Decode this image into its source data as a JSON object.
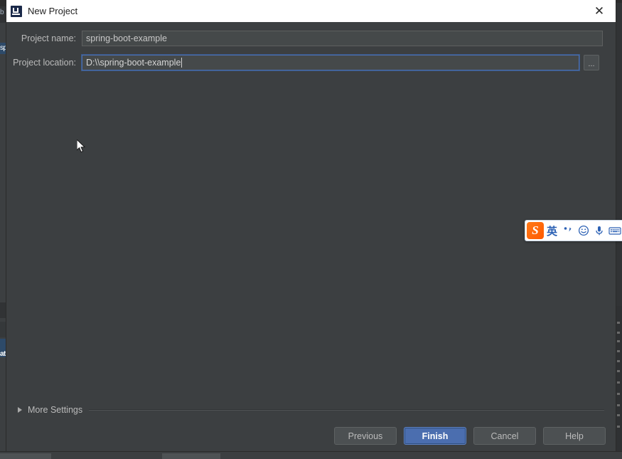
{
  "window": {
    "title": "New Project",
    "app_icon": "intellij-idea-icon",
    "close_label": "✕"
  },
  "form": {
    "fields": [
      {
        "label": "Project name:",
        "value": "spring-boot-example",
        "placeholder": "",
        "focused": false,
        "name": "project-name"
      },
      {
        "label": "Project location:",
        "value": "D:\\\\spring-boot-example",
        "placeholder": "",
        "focused": true,
        "name": "project-location"
      }
    ],
    "browse_label": "..."
  },
  "more_settings": {
    "label": "More Settings",
    "expanded": false,
    "chevron": "chevron-right-icon"
  },
  "buttons": [
    {
      "label": "Previous",
      "primary": false,
      "name": "previous-button"
    },
    {
      "label": "Finish",
      "primary": true,
      "name": "finish-button"
    },
    {
      "label": "Cancel",
      "primary": false,
      "name": "cancel-button"
    },
    {
      "label": "Help",
      "primary": false,
      "name": "help-button"
    }
  ],
  "ime": {
    "logo": "S",
    "items": [
      {
        "glyph": "英",
        "name": "ime-language-mode",
        "kind": "cjk"
      },
      {
        "glyph": "‶,",
        "name": "ime-punctuation-toggle",
        "kind": "punct"
      },
      {
        "glyph": "☺",
        "name": "ime-emoji-icon",
        "kind": "icon"
      },
      {
        "glyph": "Ἲ4",
        "name": "ime-microphone-icon",
        "kind": "icon"
      },
      {
        "glyph": "⌨",
        "name": "ime-keyboard-icon",
        "kind": "icon"
      }
    ]
  },
  "ide_background": {
    "left_sliver_labels": [
      "b",
      "sp",
      "at"
    ],
    "right_marker_count": 11
  },
  "colors": {
    "dialog_background": "#3c3f41",
    "titlebar_background": "#ffffff",
    "accent_primary": "#4b6eaf",
    "field_background": "#45494a",
    "focus_border": "#4b6eaf",
    "text_primary": "#bbbbbb",
    "ime_logo": "#ff5a00",
    "ime_text": "#2d62b5"
  }
}
